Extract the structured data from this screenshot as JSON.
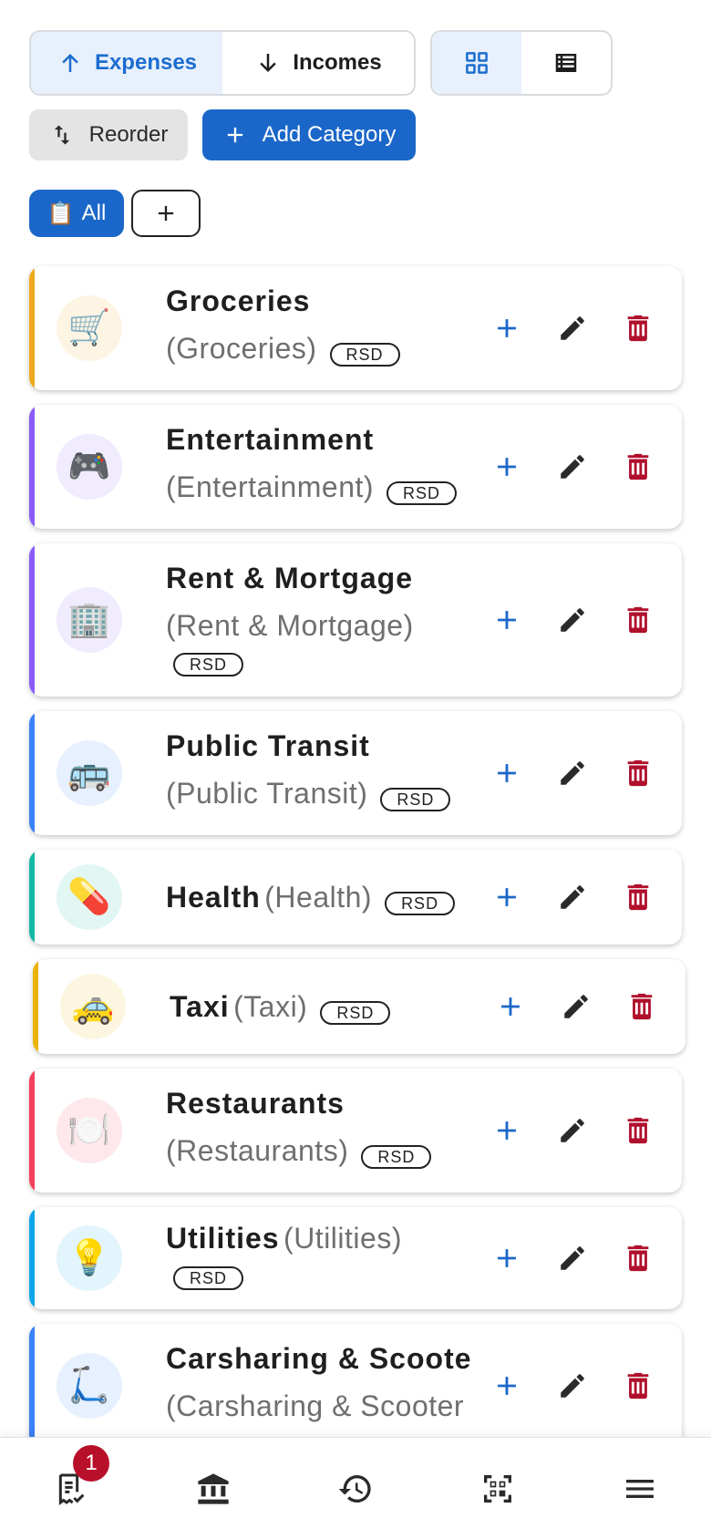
{
  "toolbar": {
    "expenses_label": "Expenses",
    "incomes_label": "Incomes",
    "reorder_label": "Reorder",
    "add_category_label": "Add Category"
  },
  "filters": {
    "all_icon": "📋",
    "all_label": "All"
  },
  "colors": {
    "primary": "#1b67c9",
    "delete": "#b0102c",
    "badge": "#b80f2a"
  },
  "categories": [
    {
      "name": "Groceries",
      "alias": "(Groceries)",
      "currency": "RSD",
      "icon": "🛒",
      "accent": "#f0a81e"
    },
    {
      "name": "Entertainment",
      "alias": "(Entertainment)",
      "currency": "RSD",
      "icon": "🎮",
      "accent": "#8b5cf6"
    },
    {
      "name": "Rent & Mortgage",
      "alias": "(Rent & Mortgage)",
      "currency": "RSD",
      "icon": "🏢",
      "accent": "#8b5cf6"
    },
    {
      "name": "Public Transit",
      "alias": "(Public Transit)",
      "currency": "RSD",
      "icon": "🚌",
      "accent": "#3b82f6"
    },
    {
      "name": "Health",
      "alias": "(Health)",
      "currency": "RSD",
      "icon": "💊",
      "accent": "#14b8a6"
    },
    {
      "name": "Taxi",
      "alias": "(Taxi)",
      "currency": "RSD",
      "icon": "🚕",
      "accent": "#eab308"
    },
    {
      "name": "Restaurants",
      "alias": "(Restaurants)",
      "currency": "RSD",
      "icon": "🍽️",
      "accent": "#f43f5e"
    },
    {
      "name": "Utilities",
      "alias": "(Utilities)",
      "currency": "RSD",
      "icon": "💡",
      "accent": "#0ea5e9"
    },
    {
      "name": "Carsharing & Scoote",
      "alias": "(Carsharing & Scooter",
      "icon": "🛴",
      "accent": "#3b82f6"
    }
  ],
  "bottom_nav": {
    "receipts_badge": "1",
    "items": [
      "receipts-icon",
      "bank-icon",
      "history-icon",
      "qr-scan-icon",
      "menu-icon"
    ]
  }
}
